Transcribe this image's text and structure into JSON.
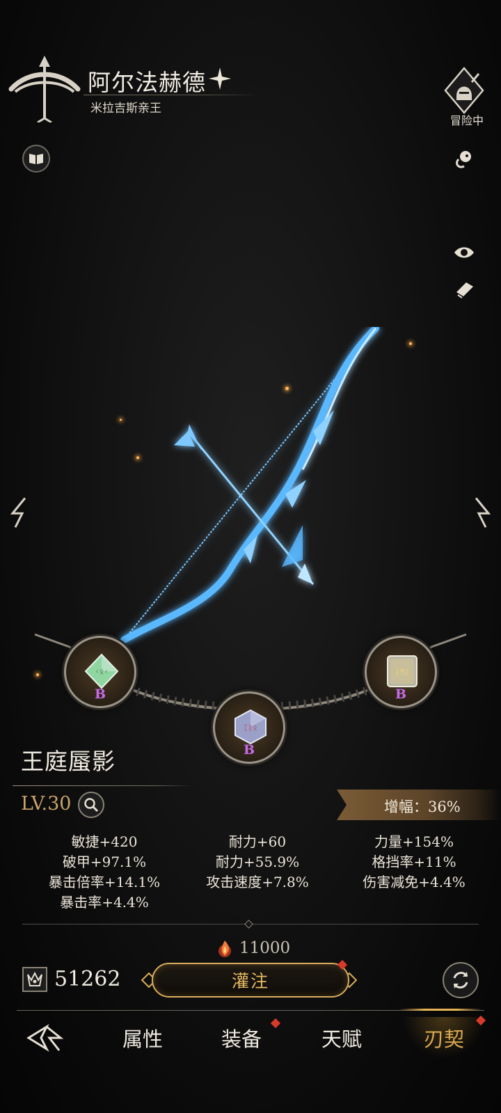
{
  "hero": {
    "name": "阿尔法赫德",
    "title": "米拉吉斯亲王",
    "class_icon": "bow-crest-icon",
    "rank_icon": "four-point-star-icon"
  },
  "status": {
    "label": "冒险中",
    "icon": "knight-helmet-icon"
  },
  "side_buttons": {
    "left": [
      "book-icon"
    ],
    "right": [
      "pet-icon",
      "eye-icon",
      "note-icon"
    ]
  },
  "weapon": {
    "name": "王庭蜃影",
    "level": "LV.30",
    "art": "ice-bow-and-arrow",
    "amplify_label": "增幅：36%",
    "sockets": [
      {
        "grade": "B",
        "gem_color": "#8fd6a0"
      },
      {
        "grade": "B",
        "gem_color": "#9aa0c8"
      },
      {
        "grade": "B",
        "gem_color": "#d8c78e"
      }
    ],
    "stats": [
      [
        "敏捷+420",
        "破甲+97.1%",
        "暴击倍率+14.1%",
        "暴击率+4.4%"
      ],
      [
        "耐力+60",
        "耐力+55.9%",
        "攻击速度+7.8%"
      ],
      [
        "力量+154%",
        "格挡率+11%",
        "伤害减免+4.4%"
      ]
    ]
  },
  "actions": {
    "cost": "11000",
    "cost_icon": "flame-orb-icon",
    "currency": "51262",
    "currency_icon": "crown-shard-icon",
    "infuse_label": "灌注",
    "refresh_icon": "refresh-icon"
  },
  "tabs": {
    "back_icon": "back-emblem-icon",
    "items": [
      "属性",
      "装备",
      "天赋",
      "刃契"
    ],
    "active": "刃契"
  },
  "colors": {
    "accent_gold": "#d9a84e",
    "rune_grade": "#c66ce8",
    "notification": "#d83a2a",
    "weapon_glow": "#5ab8ff"
  }
}
